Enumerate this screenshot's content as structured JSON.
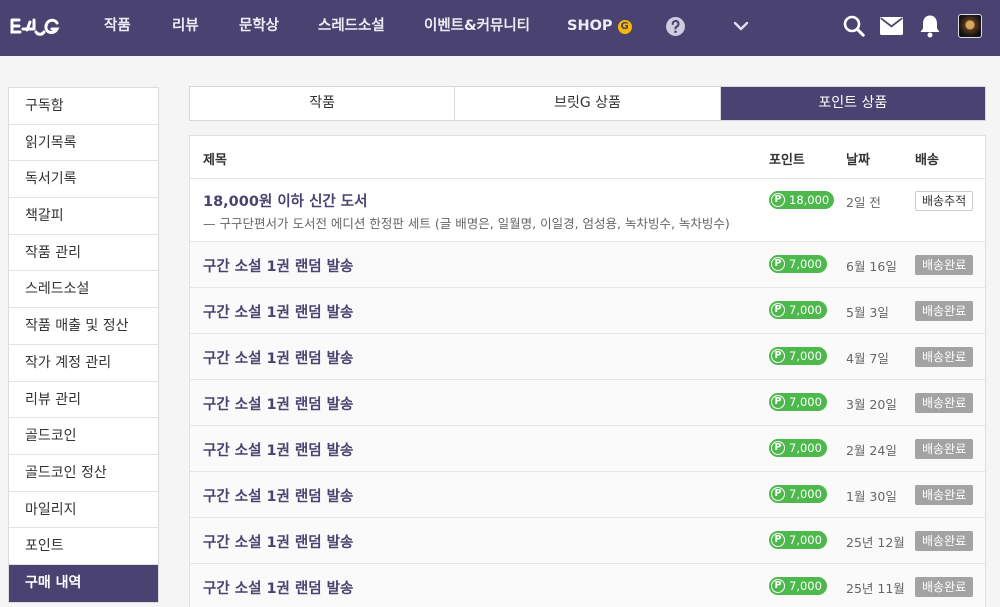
{
  "header": {
    "logo": "브릿G",
    "nav": [
      "작품",
      "리뷰",
      "문학상",
      "스레드소설",
      "이벤트&커뮤니티"
    ],
    "shop_label": "SHOP",
    "shop_badge": "G",
    "help_icon": "question-circle-icon",
    "more_icon": "chevron-down-icon",
    "search_icon": "search-icon",
    "mail_icon": "mail-icon",
    "bell_icon": "bell-icon",
    "avatar_icon": "user-avatar"
  },
  "sidebar": {
    "items": [
      {
        "label": "구독함"
      },
      {
        "label": "읽기목록"
      },
      {
        "label": "독서기록"
      },
      {
        "label": "책갈피"
      },
      {
        "label": "작품 관리"
      },
      {
        "label": "스레드소설"
      },
      {
        "label": "작품 매출 및 정산"
      },
      {
        "label": "작가 계정 관리"
      },
      {
        "label": "리뷰 관리"
      },
      {
        "label": "골드코인"
      },
      {
        "label": "골드코인 정산"
      },
      {
        "label": "마일리지"
      },
      {
        "label": "포인트"
      },
      {
        "label": "구매 내역",
        "active": true
      }
    ]
  },
  "tabs": [
    {
      "label": "작품"
    },
    {
      "label": "브릿G 상품"
    },
    {
      "label": "포인트 상품",
      "active": true
    }
  ],
  "table": {
    "headers": {
      "title": "제목",
      "points": "포인트",
      "date": "날짜",
      "shipping": "배송"
    },
    "point_symbol": "P",
    "rows": [
      {
        "title": "18,000원 이하 신간 도서",
        "subtitle": "— 구구단편서가 도서전 에디션 한정판 세트 (글 배명은, 일월명, 이일경, 엄성용, 녹차빙수, 녹차빙수)",
        "points": "18,000",
        "date": "2일 전",
        "shipping": "배송추적"
      },
      {
        "title": "구간 소설 1권 랜덤 발송",
        "points": "7,000",
        "date": "6월 16일",
        "shipping": "배송완료"
      },
      {
        "title": "구간 소설 1권 랜덤 발송",
        "points": "7,000",
        "date": "5월 3일",
        "shipping": "배송완료"
      },
      {
        "title": "구간 소설 1권 랜덤 발송",
        "points": "7,000",
        "date": "4월 7일",
        "shipping": "배송완료"
      },
      {
        "title": "구간 소설 1권 랜덤 발송",
        "points": "7,000",
        "date": "3월 20일",
        "shipping": "배송완료"
      },
      {
        "title": "구간 소설 1권 랜덤 발송",
        "points": "7,000",
        "date": "2월 24일",
        "shipping": "배송완료"
      },
      {
        "title": "구간 소설 1권 랜덤 발송",
        "points": "7,000",
        "date": "1월 30일",
        "shipping": "배송완료"
      },
      {
        "title": "구간 소설 1권 랜덤 발송",
        "points": "7,000",
        "date": "25년 12월",
        "shipping": "배송완료"
      },
      {
        "title": "구간 소설 1권 랜덤 발송",
        "points": "7,000",
        "date": "25년 11월",
        "shipping": "배송완료"
      }
    ]
  },
  "colors": {
    "brand": "#4a4270",
    "points_badge": "#4db84b",
    "shipped_badge": "#a3a3a3",
    "shop_badge": "#f5b800"
  }
}
